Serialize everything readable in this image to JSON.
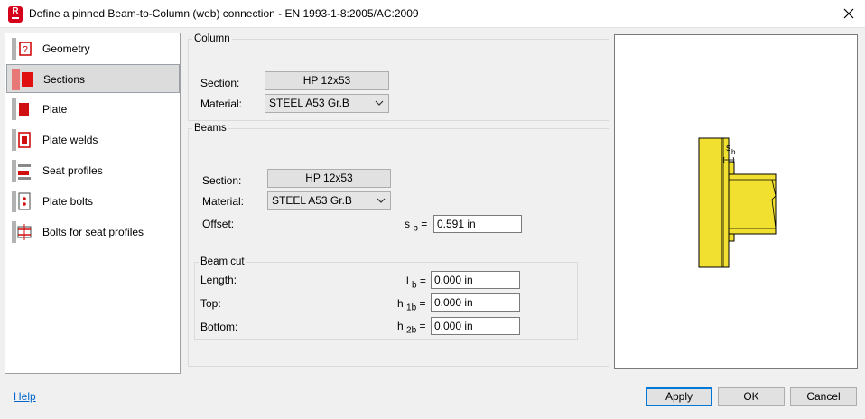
{
  "window": {
    "title": "Define a pinned Beam-to-Column (web) connection - EN 1993-1-8:2005/AC:2009",
    "app_icon_letter": "R",
    "close_icon": "close-icon"
  },
  "sidebar": {
    "items": [
      {
        "label": "Geometry",
        "icon": "geometry-icon",
        "selected": false
      },
      {
        "label": "Sections",
        "icon": "sections-icon",
        "selected": true
      },
      {
        "label": "Plate",
        "icon": "plate-icon",
        "selected": false
      },
      {
        "label": "Plate welds",
        "icon": "plate-welds-icon",
        "selected": false
      },
      {
        "label": "Seat profiles",
        "icon": "seat-profiles-icon",
        "selected": false
      },
      {
        "label": "Plate bolts",
        "icon": "plate-bolts-icon",
        "selected": false
      },
      {
        "label": "Bolts for seat profiles",
        "icon": "bolts-seat-icon",
        "selected": false
      }
    ]
  },
  "column": {
    "group_title": "Column",
    "section_label": "Section:",
    "section_value": "HP 12x53",
    "material_label": "Material:",
    "material_value": "STEEL A53 Gr.B"
  },
  "beams": {
    "group_title": "Beams",
    "section_label": "Section:",
    "section_value": "HP 12x53",
    "material_label": "Material:",
    "material_value": "STEEL A53 Gr.B",
    "offset_label": "Offset:",
    "offset_symbol": "s",
    "offset_sub": "b",
    "offset_value": "0.591 in"
  },
  "beam_cut": {
    "group_title": "Beam cut",
    "length_label": "Length:",
    "length_symbol": "l",
    "length_sub": "b",
    "length_value": "0.000 in",
    "top_label": "Top:",
    "top_symbol": "h",
    "top_sub": "1b",
    "top_value": "0.000 in",
    "bottom_label": "Bottom:",
    "bottom_symbol": "h",
    "bottom_sub": "2b",
    "bottom_value": "0.000 in"
  },
  "preview": {
    "dimension_symbol": "s",
    "dimension_sub": "b",
    "steel_color": "#f2e030",
    "outline_color": "#000000"
  },
  "footer": {
    "help_label": "Help",
    "apply_label": "Apply",
    "ok_label": "OK",
    "cancel_label": "Cancel"
  },
  "colors": {
    "accent": "#0078d7",
    "icon_red": "#d6001c"
  }
}
